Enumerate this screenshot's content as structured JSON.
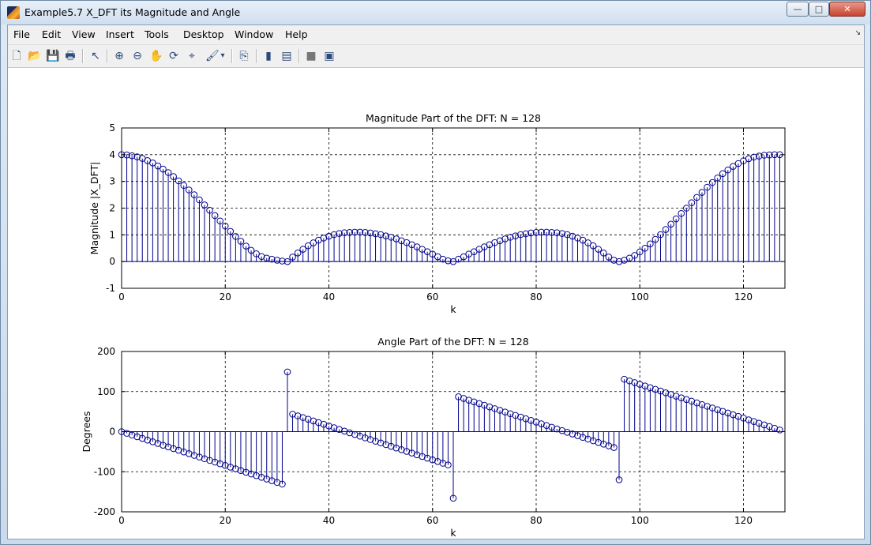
{
  "window": {
    "title": "Example5.7 X_DFT its Magnitude and Angle",
    "min_symbol": "—",
    "max_symbol": "□",
    "close_symbol": "✕"
  },
  "menu": [
    "File",
    "Edit",
    "View",
    "Insert",
    "Tools",
    "Desktop",
    "Window",
    "Help"
  ],
  "menu_overflow": "↘",
  "toolbar": {
    "icons": [
      "new-figure-icon",
      "open-file-icon",
      "save-icon",
      "print-icon",
      "pointer-icon",
      "zoom-in-icon",
      "zoom-out-icon",
      "pan-hand-icon",
      "rotate-3d-icon",
      "data-cursor-icon",
      "brush-icon",
      "brush-dropdown-icon",
      "link-plot-icon",
      "colorbar-icon",
      "legend-icon",
      "hide-plot-tools-icon",
      "show-plot-tools-icon"
    ],
    "glyphs": [
      "🗋",
      "📂",
      "💾",
      "🖶",
      "↖",
      "⊕",
      "⊖",
      "✋",
      "⟳",
      "⌖",
      "🖌",
      "▾",
      "⎘",
      "▮",
      "▤",
      "■",
      "▣"
    ]
  },
  "colors": {
    "stem": "#00008b",
    "grid": "#000000",
    "axes_bg": "#ffffff"
  },
  "chart_data": [
    {
      "type": "stem",
      "title": "Magnitude Part of the DFT: N = 128",
      "xlabel": "k",
      "ylabel": "Magnitude  |X_DFT|",
      "xlim": [
        0,
        128
      ],
      "ylim": [
        -1,
        5
      ],
      "xticks": [
        0,
        20,
        40,
        60,
        80,
        100,
        120
      ],
      "yticks": [
        -1,
        0,
        1,
        2,
        3,
        4,
        5
      ],
      "grid": true,
      "marker": "circle",
      "x": [
        0,
        1,
        2,
        3,
        4,
        5,
        6,
        7,
        8,
        9,
        10,
        11,
        12,
        13,
        14,
        15,
        16,
        17,
        18,
        19,
        20,
        21,
        22,
        23,
        24,
        25,
        26,
        27,
        28,
        29,
        30,
        31,
        32,
        33,
        34,
        35,
        36,
        37,
        38,
        39,
        40,
        41,
        42,
        43,
        44,
        45,
        46,
        47,
        48,
        49,
        50,
        51,
        52,
        53,
        54,
        55,
        56,
        57,
        58,
        59,
        60,
        61,
        62,
        63,
        64,
        65,
        66,
        67,
        68,
        69,
        70,
        71,
        72,
        73,
        74,
        75,
        76,
        77,
        78,
        79,
        80,
        81,
        82,
        83,
        84,
        85,
        86,
        87,
        88,
        89,
        90,
        91,
        92,
        93,
        94,
        95,
        96,
        97,
        98,
        99,
        100,
        101,
        102,
        103,
        104,
        105,
        106,
        107,
        108,
        109,
        110,
        111,
        112,
        113,
        114,
        115,
        116,
        117,
        118,
        119,
        120,
        121,
        122,
        123,
        124,
        125,
        126,
        127
      ],
      "y": [
        4.0,
        3.99,
        3.96,
        3.92,
        3.86,
        3.78,
        3.69,
        3.58,
        3.46,
        3.33,
        3.18,
        3.02,
        2.85,
        2.68,
        2.5,
        2.31,
        2.12,
        1.92,
        1.72,
        1.52,
        1.33,
        1.13,
        0.94,
        0.76,
        0.58,
        0.42,
        0.29,
        0.19,
        0.13,
        0.09,
        0.05,
        0.02,
        0.0,
        0.17,
        0.32,
        0.46,
        0.59,
        0.7,
        0.8,
        0.88,
        0.95,
        1.01,
        1.05,
        1.08,
        1.09,
        1.1,
        1.1,
        1.09,
        1.07,
        1.04,
        1.01,
        0.96,
        0.91,
        0.85,
        0.78,
        0.71,
        0.63,
        0.55,
        0.46,
        0.37,
        0.28,
        0.18,
        0.09,
        0.03,
        0.0,
        0.09,
        0.18,
        0.28,
        0.37,
        0.46,
        0.55,
        0.63,
        0.71,
        0.78,
        0.85,
        0.91,
        0.96,
        1.01,
        1.04,
        1.07,
        1.09,
        1.1,
        1.1,
        1.09,
        1.08,
        1.05,
        1.01,
        0.95,
        0.88,
        0.8,
        0.7,
        0.59,
        0.46,
        0.32,
        0.17,
        0.05,
        0.0,
        0.05,
        0.13,
        0.23,
        0.36,
        0.5,
        0.66,
        0.83,
        1.01,
        1.2,
        1.4,
        1.6,
        1.8,
        2.0,
        2.2,
        2.4,
        2.59,
        2.78,
        2.96,
        3.13,
        3.29,
        3.43,
        3.56,
        3.67,
        3.77,
        3.85,
        3.91,
        3.95,
        3.98,
        3.99,
        4.0,
        4.0
      ]
    },
    {
      "type": "stem",
      "title": "Angle Part of the DFT: N = 128",
      "xlabel": "k",
      "ylabel": "Degrees",
      "xlim": [
        0,
        128
      ],
      "ylim": [
        -200,
        200
      ],
      "xticks": [
        0,
        20,
        40,
        60,
        80,
        100,
        120
      ],
      "yticks": [
        -200,
        -100,
        0,
        100,
        200
      ],
      "grid": true,
      "marker": "circle",
      "x": [
        0,
        1,
        2,
        3,
        4,
        5,
        6,
        7,
        8,
        9,
        10,
        11,
        12,
        13,
        14,
        15,
        16,
        17,
        18,
        19,
        20,
        21,
        22,
        23,
        24,
        25,
        26,
        27,
        28,
        29,
        30,
        31,
        32,
        33,
        34,
        35,
        36,
        37,
        38,
        39,
        40,
        41,
        42,
        43,
        44,
        45,
        46,
        47,
        48,
        49,
        50,
        51,
        52,
        53,
        54,
        55,
        56,
        57,
        58,
        59,
        60,
        61,
        62,
        63,
        64,
        65,
        66,
        67,
        68,
        69,
        70,
        71,
        72,
        73,
        74,
        75,
        76,
        77,
        78,
        79,
        80,
        81,
        82,
        83,
        84,
        85,
        86,
        87,
        88,
        89,
        90,
        91,
        92,
        93,
        94,
        95,
        96,
        97,
        98,
        99,
        100,
        101,
        102,
        103,
        104,
        105,
        106,
        107,
        108,
        109,
        110,
        111,
        112,
        113,
        114,
        115,
        116,
        117,
        118,
        119,
        120,
        121,
        122,
        123,
        124,
        125,
        126,
        127
      ],
      "y": [
        0.0,
        -4.2,
        -8.4,
        -12.7,
        -16.9,
        -21.1,
        -25.3,
        -29.5,
        -33.8,
        -38.0,
        -42.2,
        -46.4,
        -50.6,
        -54.8,
        -59.1,
        -63.3,
        -67.5,
        -71.7,
        -75.9,
        -80.2,
        -84.4,
        -88.6,
        -92.8,
        -97.0,
        -101.3,
        -105.5,
        -109.7,
        -113.9,
        -118.1,
        -122.3,
        -126.6,
        -130.8,
        149.0,
        43.6,
        39.4,
        35.2,
        30.9,
        26.7,
        22.5,
        18.3,
        14.1,
        9.8,
        5.6,
        1.4,
        -2.8,
        -7.0,
        -11.3,
        -15.5,
        -19.7,
        -23.9,
        -28.1,
        -32.3,
        -36.6,
        -40.8,
        -45.0,
        -49.2,
        -53.4,
        -57.7,
        -61.9,
        -66.1,
        -70.3,
        -74.5,
        -78.8,
        -83.0,
        -166.0,
        87.0,
        82.8,
        78.5,
        74.3,
        70.1,
        65.9,
        61.7,
        57.4,
        53.2,
        49.0,
        44.8,
        40.6,
        36.4,
        32.1,
        27.9,
        23.7,
        19.5,
        15.3,
        11.0,
        6.8,
        2.6,
        -1.6,
        -5.8,
        -10.0,
        -14.3,
        -18.5,
        -22.7,
        -26.9,
        -31.1,
        -35.4,
        -39.6,
        -120.0,
        130.8,
        126.6,
        122.3,
        118.1,
        113.9,
        109.7,
        105.5,
        101.3,
        97.0,
        92.8,
        88.6,
        84.4,
        80.2,
        75.9,
        71.7,
        67.5,
        63.3,
        59.1,
        54.8,
        50.6,
        46.4,
        42.2,
        38.0,
        33.8,
        29.5,
        25.3,
        21.1,
        16.9,
        12.7,
        8.4,
        4.2
      ]
    }
  ]
}
